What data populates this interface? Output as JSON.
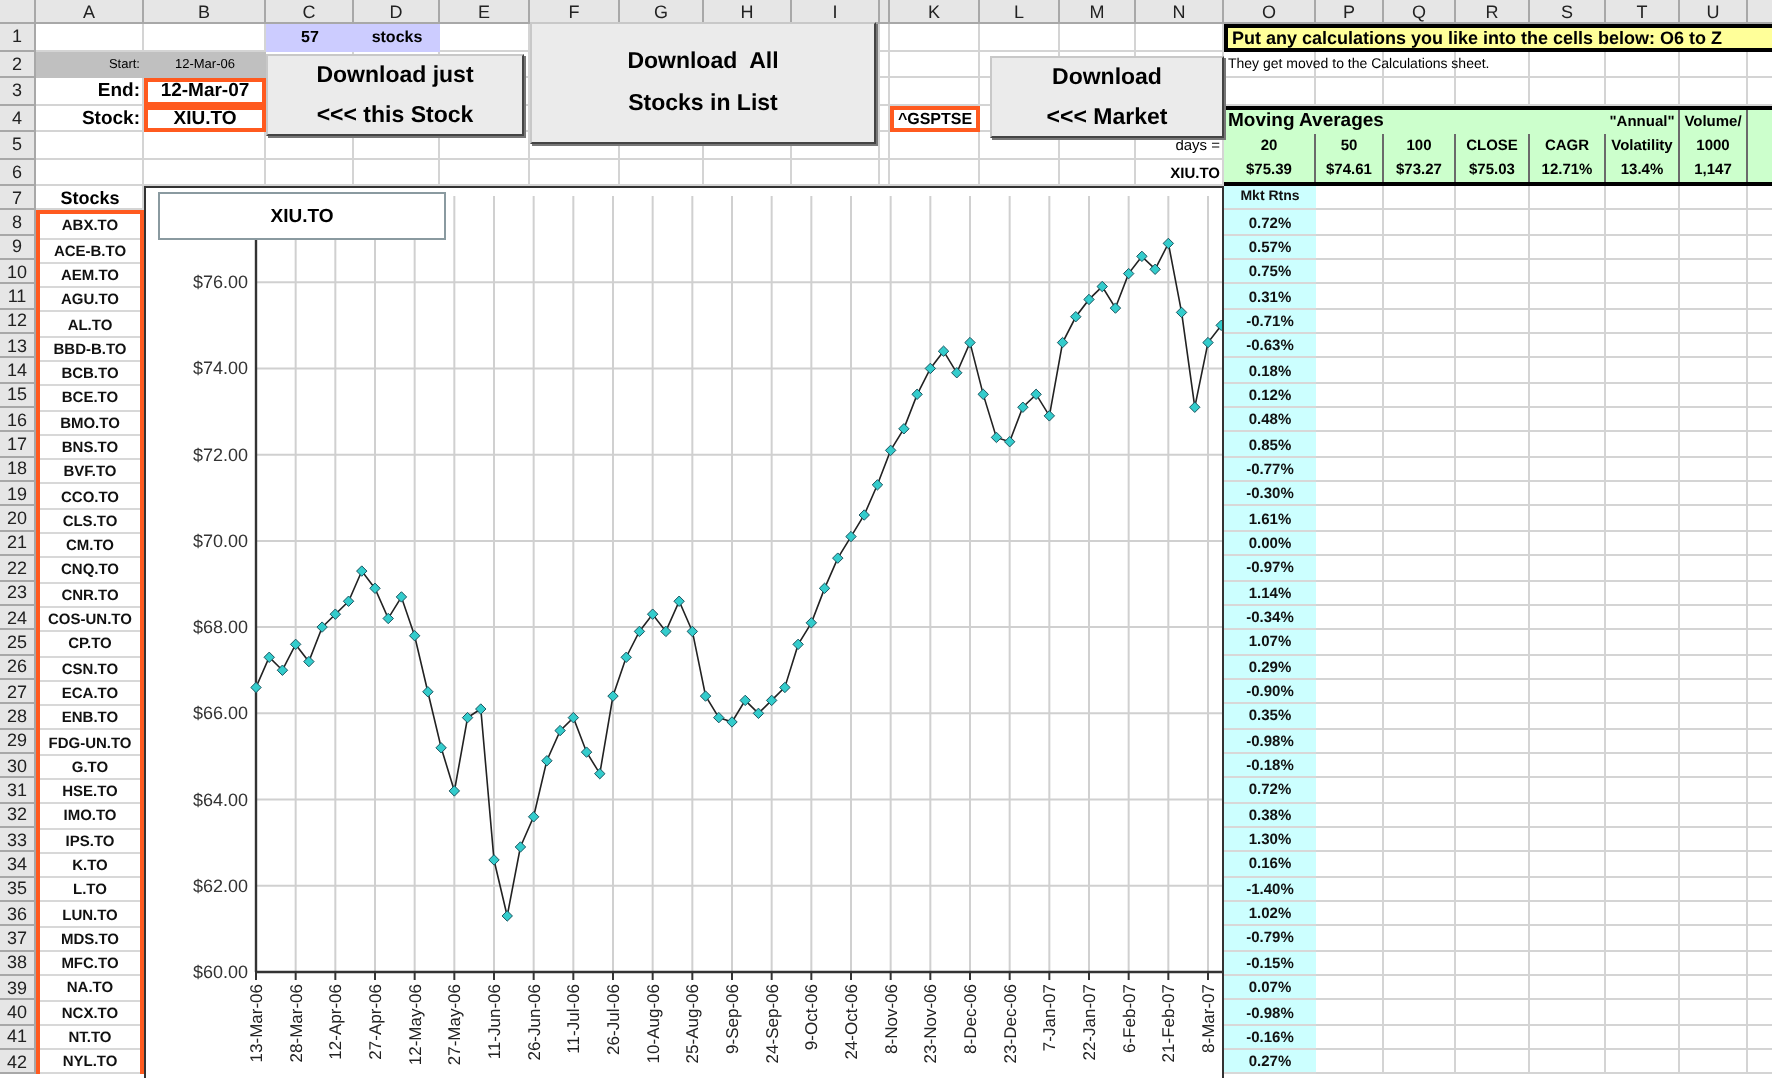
{
  "column_headers": [
    "A",
    "B",
    "C",
    "D",
    "E",
    "F",
    "G",
    "H",
    "I",
    "K",
    "L",
    "M",
    "N",
    "O",
    "P",
    "Q",
    "R",
    "S",
    "T",
    "U"
  ],
  "row_numbers": [
    "1",
    "2",
    "3",
    "4",
    "5",
    "6",
    "7",
    "8",
    "9",
    "10",
    "11",
    "12",
    "13",
    "14",
    "15",
    "16",
    "17",
    "18",
    "19",
    "20",
    "21",
    "22",
    "23",
    "24",
    "25",
    "26",
    "27",
    "28",
    "29",
    "30",
    "31",
    "32",
    "33",
    "34",
    "35",
    "36",
    "37",
    "38",
    "39",
    "40",
    "41",
    "42"
  ],
  "stock_count": {
    "count": "57",
    "label": "stocks"
  },
  "date_range": {
    "start_label": "Start:",
    "start": "12-Mar-06",
    "end_label": "End:",
    "end": "12-Mar-07"
  },
  "stock": {
    "label": "Stock:",
    "value": "XIU.TO"
  },
  "market_index": "^GSPTSE",
  "buttons": [
    {
      "lines": [
        "Download just",
        "<<< this Stock"
      ]
    },
    {
      "lines": [
        "Download  All",
        "Stocks in List"
      ]
    },
    {
      "lines": [
        "Download",
        "<<< Market"
      ]
    }
  ],
  "banner": "Put any calculations you like into the cells below: O6 to Z",
  "note": "They get moved to the Calculations sheet.",
  "stats": {
    "title": "Moving Averages",
    "days_label": "days =",
    "ticker": "XIU.TO",
    "columns": [
      {
        "lines": [
          "20"
        ],
        "value": "$75.39"
      },
      {
        "lines": [
          "50"
        ],
        "value": "$74.61"
      },
      {
        "lines": [
          "100"
        ],
        "value": "$73.27"
      },
      {
        "lines": [
          "CLOSE"
        ],
        "value": "$75.03"
      },
      {
        "lines": [
          "CAGR"
        ],
        "value": "12.71%"
      },
      {
        "lines": [
          "\"Annual\"",
          "Volatility"
        ],
        "value": "13.4%"
      },
      {
        "lines": [
          "Volume/",
          "1000"
        ],
        "value": "1,147"
      }
    ]
  },
  "stocks": {
    "header": "Stocks",
    "items": [
      "ABX.TO",
      "ACE-B.TO",
      "AEM.TO",
      "AGU.TO",
      "AL.TO",
      "BBD-B.TO",
      "BCB.TO",
      "BCE.TO",
      "BMO.TO",
      "BNS.TO",
      "BVF.TO",
      "CCO.TO",
      "CLS.TO",
      "CM.TO",
      "CNQ.TO",
      "CNR.TO",
      "COS-UN.TO",
      "CP.TO",
      "CSN.TO",
      "ECA.TO",
      "ENB.TO",
      "FDG-UN.TO",
      "G.TO",
      "HSE.TO",
      "IMO.TO",
      "IPS.TO",
      "K.TO",
      "L.TO",
      "LUN.TO",
      "MDS.TO",
      "MFC.TO",
      "NA.TO",
      "NCX.TO",
      "NT.TO",
      "NYL.TO"
    ]
  },
  "returns": {
    "header": "Mkt Rtns",
    "items": [
      "0.72%",
      "0.57%",
      "0.75%",
      "0.31%",
      "-0.71%",
      "-0.63%",
      "0.18%",
      "0.12%",
      "0.48%",
      "0.85%",
      "-0.77%",
      "-0.30%",
      "1.61%",
      "0.00%",
      "-0.97%",
      "1.14%",
      "-0.34%",
      "1.07%",
      "0.29%",
      "-0.90%",
      "0.35%",
      "-0.98%",
      "-0.18%",
      "0.72%",
      "0.38%",
      "1.30%",
      "0.16%",
      "-1.40%",
      "1.02%",
      "-0.79%",
      "-0.15%",
      "0.07%",
      "-0.98%",
      "-0.16%",
      "0.27%"
    ]
  },
  "chart": {
    "title": "XIU.TO",
    "chart_data": {
      "type": "line",
      "grid": true,
      "ylim": [
        60,
        78
      ],
      "categories": [
        "13-Mar-06",
        null,
        null,
        "28-Mar-06",
        null,
        null,
        "12-Apr-06",
        null,
        null,
        "27-Apr-06",
        null,
        null,
        "12-May-06",
        null,
        null,
        "27-May-06",
        null,
        null,
        "11-Jun-06",
        null,
        null,
        "26-Jun-06",
        null,
        null,
        "11-Jul-06",
        null,
        null,
        "26-Jul-06",
        null,
        null,
        "10-Aug-06",
        null,
        null,
        "25-Aug-06",
        null,
        null,
        "9-Sep-06",
        null,
        null,
        "24-Sep-06",
        null,
        null,
        "9-Oct-06",
        null,
        null,
        "24-Oct-06",
        null,
        null,
        "8-Nov-06",
        null,
        null,
        "23-Nov-06",
        null,
        null,
        "8-Dec-06",
        null,
        null,
        "23-Dec-06",
        null,
        null,
        "7-Jan-07",
        null,
        null,
        "22-Jan-07",
        null,
        null,
        "6-Feb-07",
        null,
        null,
        "21-Feb-07",
        null,
        null,
        "8-Mar-07",
        null
      ],
      "yticks": [
        {
          "value": 60,
          "label": "$60.00"
        },
        {
          "value": 62,
          "label": "$62.00"
        },
        {
          "value": 64,
          "label": "$64.00"
        },
        {
          "value": 66,
          "label": "$66.00"
        },
        {
          "value": 68,
          "label": "$68.00"
        },
        {
          "value": 70,
          "label": "$70.00"
        },
        {
          "value": 72,
          "label": "$72.00"
        },
        {
          "value": 74,
          "label": "$74.00"
        },
        {
          "value": 76,
          "label": "$76.00"
        }
      ],
      "series": [
        {
          "color": "#33cccc",
          "marker": "diamond",
          "values": [
            66.6,
            67.3,
            67.0,
            67.6,
            67.2,
            68.0,
            68.3,
            68.6,
            69.3,
            68.9,
            68.2,
            68.7,
            67.8,
            66.5,
            65.2,
            64.2,
            65.9,
            66.1,
            62.6,
            61.3,
            62.9,
            63.6,
            64.9,
            65.6,
            65.9,
            65.1,
            64.6,
            66.4,
            67.3,
            67.9,
            68.3,
            67.9,
            68.6,
            67.9,
            66.4,
            65.9,
            65.8,
            66.3,
            66.0,
            66.3,
            66.6,
            67.6,
            68.1,
            68.9,
            69.6,
            70.1,
            70.6,
            71.3,
            72.1,
            72.6,
            73.4,
            74.0,
            74.4,
            73.9,
            74.6,
            73.4,
            72.4,
            72.3,
            73.1,
            73.4,
            72.9,
            74.6,
            75.2,
            75.6,
            75.9,
            75.4,
            76.2,
            76.6,
            76.3,
            76.9,
            75.3,
            73.1,
            74.6,
            75.0
          ]
        }
      ]
    }
  }
}
